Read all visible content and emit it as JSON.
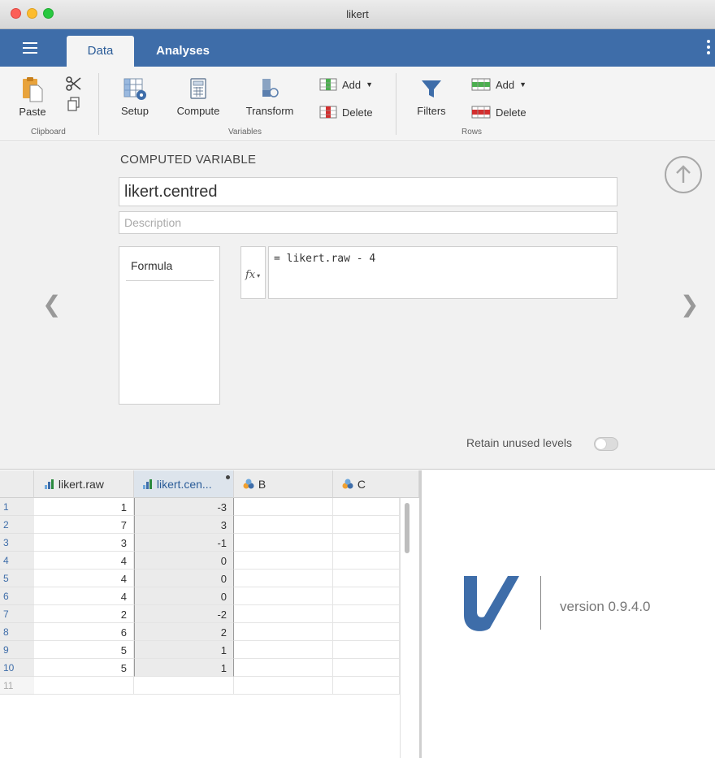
{
  "window": {
    "title": "likert"
  },
  "tabs": {
    "data": "Data",
    "analyses": "Analyses"
  },
  "ribbon": {
    "paste": "Paste",
    "clipboard_group": "Clipboard",
    "setup": "Setup",
    "compute": "Compute",
    "transform": "Transform",
    "add": "Add",
    "delete": "Delete",
    "variables_group": "Variables",
    "filters": "Filters",
    "rows_add": "Add",
    "rows_delete": "Delete",
    "rows_group": "Rows"
  },
  "computed": {
    "heading": "COMPUTED VARIABLE",
    "name": "likert.centred",
    "description_placeholder": "Description",
    "formula_tab": "Formula",
    "fx_label": "fx",
    "formula": "= likert.raw - 4",
    "retain_label": "Retain unused levels",
    "retain_on": false
  },
  "sheet": {
    "columns": [
      "likert.raw",
      "likert.cen...",
      "B",
      "C"
    ],
    "rows": [
      {
        "n": "1",
        "raw": "1",
        "cen": "-3"
      },
      {
        "n": "2",
        "raw": "7",
        "cen": "3"
      },
      {
        "n": "3",
        "raw": "3",
        "cen": "-1"
      },
      {
        "n": "4",
        "raw": "4",
        "cen": "0"
      },
      {
        "n": "5",
        "raw": "4",
        "cen": "0"
      },
      {
        "n": "6",
        "raw": "4",
        "cen": "0"
      },
      {
        "n": "7",
        "raw": "2",
        "cen": "-2"
      },
      {
        "n": "8",
        "raw": "6",
        "cen": "2"
      },
      {
        "n": "9",
        "raw": "5",
        "cen": "1"
      },
      {
        "n": "10",
        "raw": "5",
        "cen": "1"
      },
      {
        "n": "11",
        "raw": "",
        "cen": ""
      }
    ]
  },
  "results": {
    "version": "version 0.9.4.0"
  },
  "colors": {
    "brand_blue": "#3e6da9",
    "toolbar": "#f4f4f4",
    "panel": "#f1f1f1"
  }
}
